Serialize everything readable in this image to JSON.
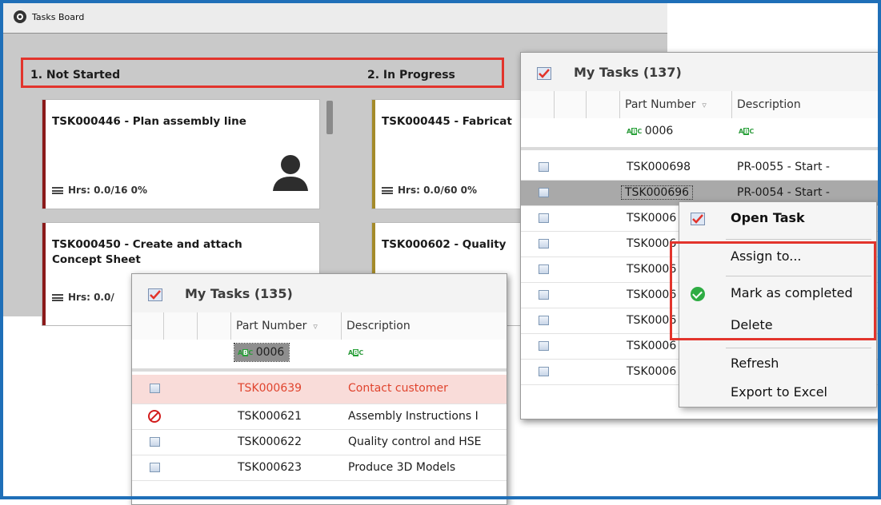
{
  "board": {
    "title": "Tasks Board",
    "columns": [
      "1. Not Started",
      "2. In Progress"
    ],
    "cards": [
      {
        "title": "TSK000446 - Plan assembly line",
        "hours": "Hrs: 0.0/16 0%",
        "color": "#8b1a1a"
      },
      {
        "title": "TSK000445 - Fabricat",
        "hours": "Hrs: 0.0/60 0%",
        "color": "#a48b2a"
      },
      {
        "title_line1": "TSK000450 - Create and attach",
        "title_line2": "Concept Sheet",
        "hours": "Hrs: 0.0/",
        "color": "#8b1a1a"
      },
      {
        "title": "TSK000602 - Quality",
        "color": "#a48b2a"
      }
    ]
  },
  "grid_back": {
    "title": "My Tasks (137)",
    "columns": [
      "Part Number",
      "Description"
    ],
    "filter": {
      "part": "0006",
      "desc": ""
    },
    "rows": [
      {
        "part": "TSK000698",
        "desc": "PR-0055 - Start -"
      },
      {
        "part": "TSK000696",
        "desc": "PR-0054 - Start -",
        "selected": true
      },
      {
        "part": "TSK0006",
        "desc": ""
      },
      {
        "part": "TSK0006",
        "desc": ""
      },
      {
        "part": "TSK0006",
        "desc": ""
      },
      {
        "part": "TSK0006",
        "desc": ""
      },
      {
        "part": "TSK0006",
        "desc": ""
      },
      {
        "part": "TSK0006",
        "desc": ""
      },
      {
        "part": "TSK0006",
        "desc": ""
      }
    ]
  },
  "grid_front": {
    "title": "My Tasks (135)",
    "columns": [
      "Part Number",
      "Description"
    ],
    "filter": {
      "part": "0006",
      "desc": ""
    },
    "rows": [
      {
        "part": "TSK000639",
        "desc": "Contact customer",
        "status": "overdue"
      },
      {
        "part": "TSK000621",
        "desc": "Assembly Instructions I",
        "status": "blocked"
      },
      {
        "part": "TSK000622",
        "desc": "Quality control and HSE",
        "status": "normal"
      },
      {
        "part": "TSK000623",
        "desc": "Produce 3D Models",
        "status": "normal"
      }
    ]
  },
  "context_menu": {
    "items": [
      "Open Task",
      "Assign to...",
      "Mark as completed",
      "Delete",
      "Refresh",
      "Export to Excel"
    ]
  },
  "colors": {
    "highlight": "#e2342c",
    "overdue_text": "#e0442e",
    "overdue_row": "#f9dcd9",
    "selected_row": "#a9a9a9",
    "frame": "#1f6fb8"
  }
}
